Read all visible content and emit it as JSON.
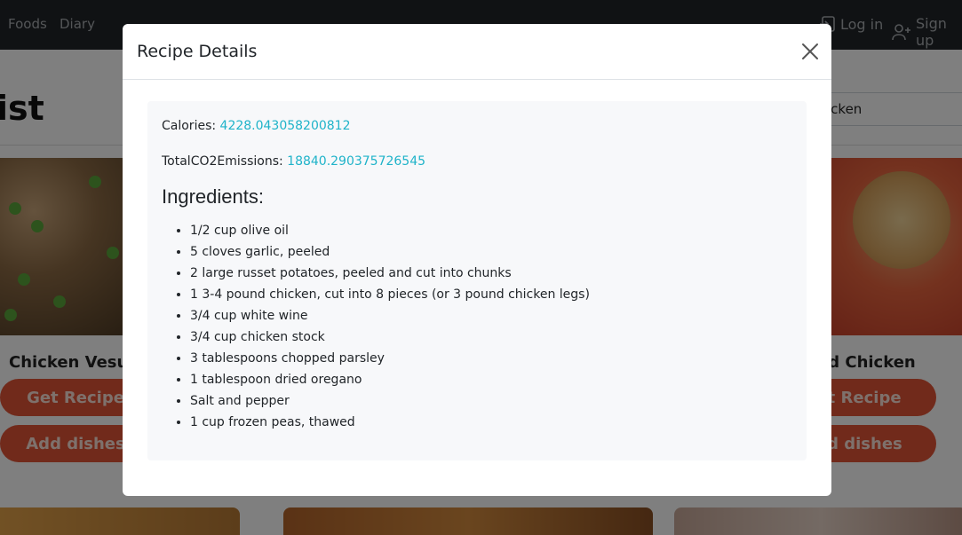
{
  "nav": {
    "links": [
      "Foods",
      "Diary"
    ],
    "login_label": "Log in",
    "signup_label": "Sign up"
  },
  "page": {
    "title": "ist",
    "search_value": "icken"
  },
  "cards": [
    {
      "title": "Chicken Vesuv",
      "get_recipe_label": "Get Recipe",
      "add_dishes_label": "Add dishes"
    },
    {
      "title": "ed Chicken",
      "get_recipe_label": "et Recipe",
      "add_dishes_label": "dd dishes"
    }
  ],
  "modal": {
    "title": "Recipe Details",
    "calories_label": "Calories: ",
    "calories_value": "4228.043058200812",
    "co2_label": "TotalCO2Emissions: ",
    "co2_value": "18840.290375726545",
    "ingredients_heading": "Ingredients:",
    "ingredients": [
      "1/2 cup olive oil",
      "5 cloves garlic, peeled",
      "2 large russet potatoes, peeled and cut into chunks",
      "1 3-4 pound chicken, cut into 8 pieces (or 3 pound chicken legs)",
      "3/4 cup white wine",
      "3/4 cup chicken stock",
      "3 tablespoons chopped parsley",
      "1 tablespoon dried oregano",
      "Salt and pepper",
      "1 cup frozen peas, thawed"
    ]
  },
  "colors": {
    "navbar": "#212529",
    "accent_button": "#e25537",
    "link_value": "#1fb3c9",
    "body_box": "#f7f8fa"
  }
}
